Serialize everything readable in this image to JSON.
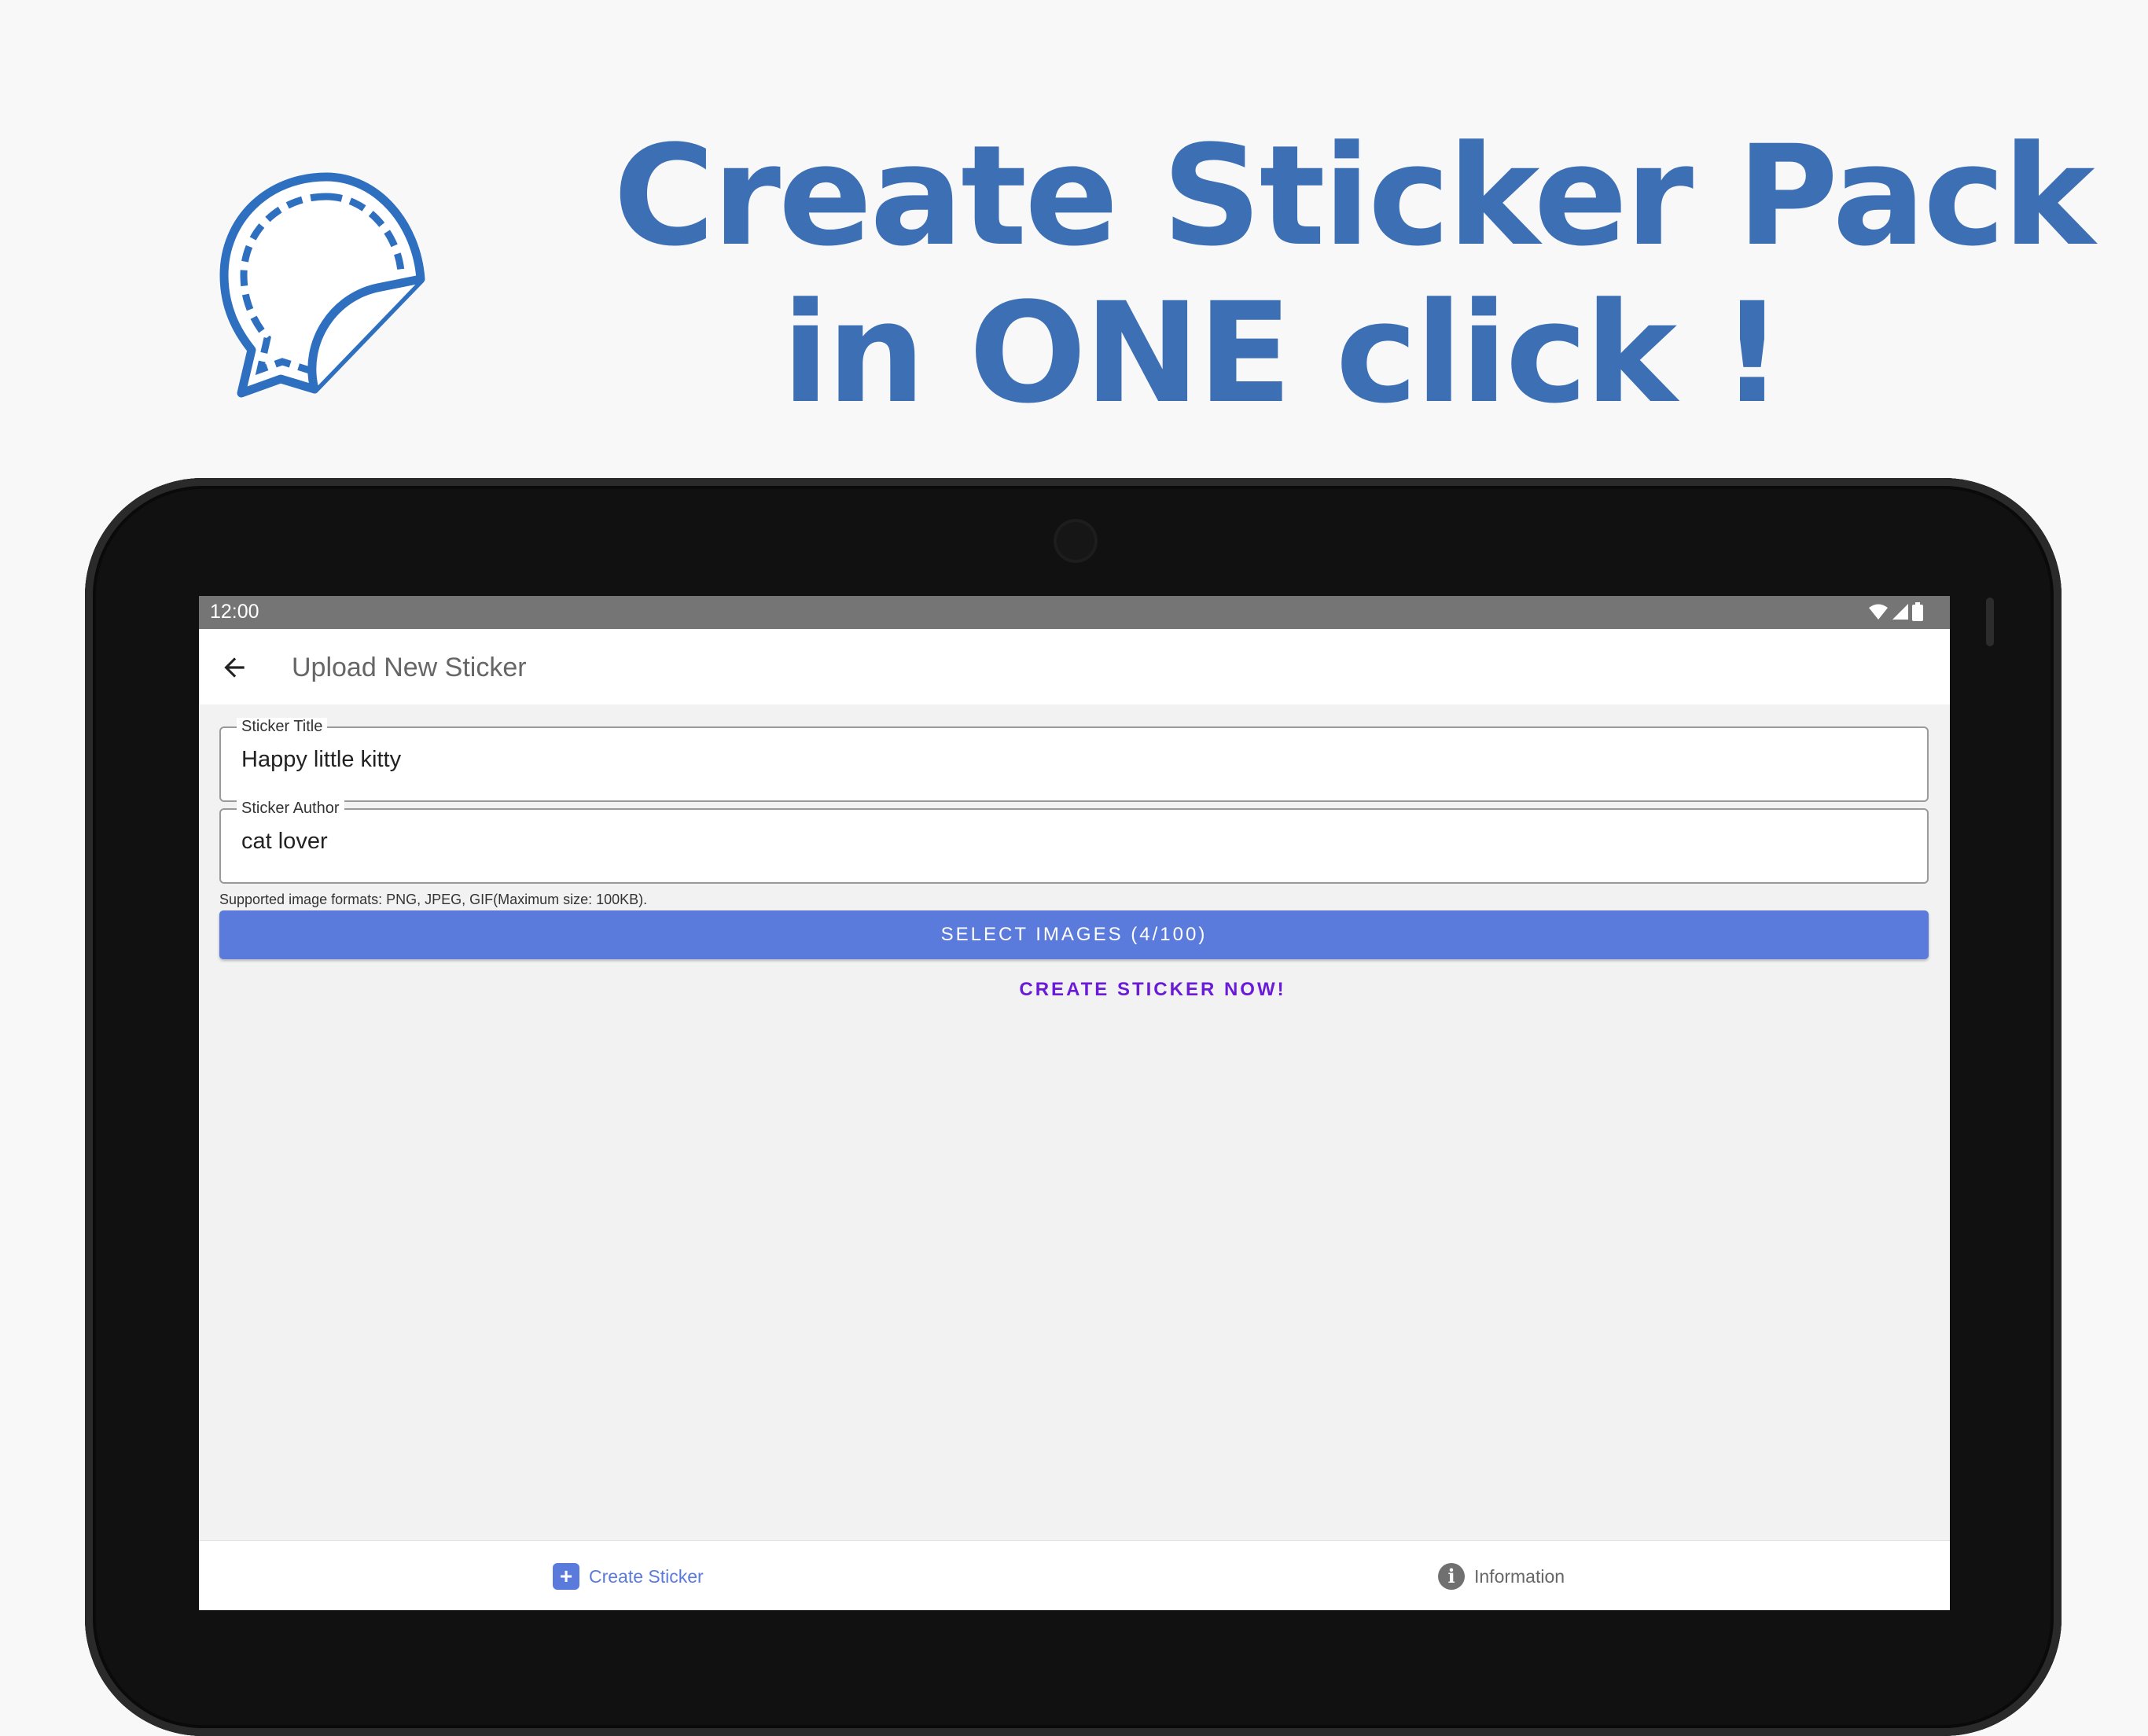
{
  "promo": {
    "headline_line1": "Create Sticker Pack",
    "headline_line2": "in ONE click !",
    "brand_color": "#3d6fb5"
  },
  "statusbar": {
    "time": "12:00",
    "icons": [
      "wifi-icon",
      "signal-icon",
      "battery-icon"
    ]
  },
  "appbar": {
    "title": "Upload New Sticker",
    "back_icon": "arrow-left-icon"
  },
  "form": {
    "title_field": {
      "label": "Sticker Title",
      "value": "Happy little kitty"
    },
    "author_field": {
      "label": "Sticker Author",
      "value": "cat lover"
    },
    "formats_hint": "Supported image formats: PNG, JPEG, GIF(Maximum size: 100KB).",
    "select_button": "SELECT IMAGES (4/100)",
    "create_button": "CREATE STICKER NOW!"
  },
  "bottom_nav": {
    "items": [
      {
        "label": "Create Sticker",
        "icon": "add-sticker-icon",
        "active": true
      },
      {
        "label": "Information",
        "icon": "info-icon",
        "active": false
      }
    ]
  },
  "colors": {
    "accent": "#5b7bdc",
    "create_text": "#6a1bd8",
    "statusbar": "#757575"
  }
}
